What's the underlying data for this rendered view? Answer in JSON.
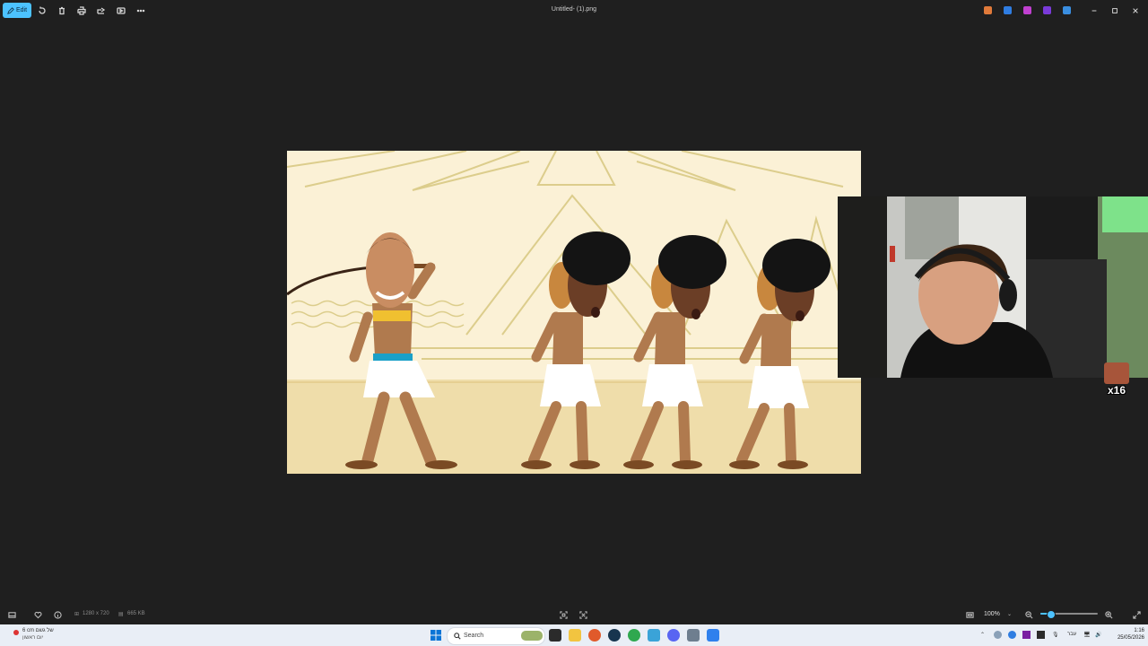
{
  "toolbar": {
    "edit_label": "Edit",
    "icons": [
      "rotate-icon",
      "delete-icon",
      "print-icon",
      "share-icon",
      "slideshow-icon",
      "more-icon"
    ]
  },
  "window": {
    "title": "Untitled- (1).png"
  },
  "overlay": {
    "emote_count": "x16"
  },
  "status": {
    "dimensions": "1280 x 720",
    "file_size": "665 KB",
    "zoom": "100%",
    "zoom_level": 0.18
  },
  "taskbar": {
    "weather_line1": "6 cm של גשם",
    "weather_line2": "יום ראשון",
    "search_placeholder": "Search",
    "language": "עבר",
    "time": "1:16",
    "date": "25/05/2026"
  },
  "colors": {
    "accent": "#4cc2ff",
    "canvas_bg": "#fbf1d6",
    "app_bg": "#1f1f1f"
  }
}
